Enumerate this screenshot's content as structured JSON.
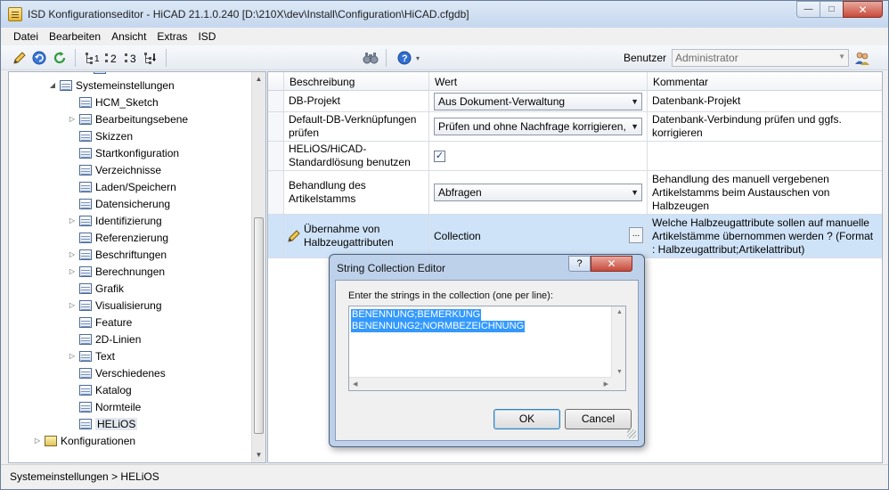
{
  "window": {
    "title": "ISD Konfigurationseditor  -  HiCAD 21.1.0.240 [D:\\210X\\dev\\Install\\Configuration\\HiCAD.cfgdb]",
    "minimize_glyph": "—",
    "maximize_glyph": "□",
    "close_glyph": "✕"
  },
  "menu": [
    "Datei",
    "Bearbeiten",
    "Ansicht",
    "Extras",
    "ISD"
  ],
  "toolbar": {
    "user_label": "Benutzer",
    "user_value": "Administrator",
    "icons": [
      "pencil-icon",
      "undo-icon",
      "refresh-icon",
      "level-icon",
      "level-2-icon",
      "level-3-icon",
      "level-all-icon",
      "binoculars-icon",
      "help-icon",
      "users-icon"
    ]
  },
  "tree": {
    "items": [
      {
        "label": "Systemeinstellungen",
        "indent": 3,
        "expander": "◢",
        "icon": "table"
      },
      {
        "label": "HCM_Sketch",
        "indent": 4,
        "expander": "",
        "icon": "table"
      },
      {
        "label": "Bearbeitungsebene",
        "indent": 4,
        "expander": "▷",
        "icon": "table"
      },
      {
        "label": "Skizzen",
        "indent": 4,
        "expander": "",
        "icon": "table"
      },
      {
        "label": "Startkonfiguration",
        "indent": 4,
        "expander": "",
        "icon": "table"
      },
      {
        "label": "Verzeichnisse",
        "indent": 4,
        "expander": "",
        "icon": "table"
      },
      {
        "label": "Laden/Speichern",
        "indent": 4,
        "expander": "",
        "icon": "table"
      },
      {
        "label": "Datensicherung",
        "indent": 4,
        "expander": "",
        "icon": "table"
      },
      {
        "label": "Identifizierung",
        "indent": 4,
        "expander": "▷",
        "icon": "table"
      },
      {
        "label": "Referenzierung",
        "indent": 4,
        "expander": "",
        "icon": "table"
      },
      {
        "label": "Beschriftungen",
        "indent": 4,
        "expander": "▷",
        "icon": "table"
      },
      {
        "label": "Berechnungen",
        "indent": 4,
        "expander": "▷",
        "icon": "table"
      },
      {
        "label": "Grafik",
        "indent": 4,
        "expander": "",
        "icon": "table"
      },
      {
        "label": "Visualisierung",
        "indent": 4,
        "expander": "▷",
        "icon": "table"
      },
      {
        "label": "Feature",
        "indent": 4,
        "expander": "",
        "icon": "table"
      },
      {
        "label": "2D-Linien",
        "indent": 4,
        "expander": "",
        "icon": "table"
      },
      {
        "label": "Text",
        "indent": 4,
        "expander": "▷",
        "icon": "table"
      },
      {
        "label": "Verschiedenes",
        "indent": 4,
        "expander": "",
        "icon": "table"
      },
      {
        "label": "Katalog",
        "indent": 4,
        "expander": "",
        "icon": "table"
      },
      {
        "label": "Normteile",
        "indent": 4,
        "expander": "",
        "icon": "table"
      },
      {
        "label": "HELiOS",
        "indent": 4,
        "expander": "",
        "icon": "table",
        "selected": true
      },
      {
        "label": "Konfigurationen",
        "indent": 1,
        "expander": "▷",
        "icon": "folder"
      }
    ]
  },
  "grid": {
    "headers": {
      "description": "Beschreibung",
      "value": "Wert",
      "comment": "Kommentar"
    },
    "rows": [
      {
        "description": "DB-Projekt",
        "value_type": "dropdown",
        "value": "Aus Dokument-Verwaltung",
        "comment": "Datenbank-Projekt"
      },
      {
        "description": "Default-DB-Verknüpfungen prüfen",
        "value_type": "dropdown",
        "value": "Prüfen und ohne Nachfrage korrigieren,",
        "comment": "Datenbank-Verbindung prüfen und ggfs. korrigieren"
      },
      {
        "description": "HELiOS/HiCAD-Standardlösung benutzen",
        "value_type": "checkbox",
        "value": "✓",
        "comment": ""
      },
      {
        "description": "Behandlung des Artikelstamms",
        "value_type": "dropdown",
        "value": "Abfragen",
        "comment": "Behandlung des manuell vergebenen Artikelstamms beim Austauschen von Halbzeugen"
      },
      {
        "description": "Übernahme von Halbzeugattributen",
        "value_type": "collection",
        "value": "Collection",
        "button": "...",
        "comment": "Welche Halbzeugattribute sollen auf manuelle Artikelstämme übernommen werden ? (Format : Halbzeugattribut;Artikelattribut)",
        "selected": true
      }
    ]
  },
  "status": {
    "path": "Systemeinstellungen > HELiOS"
  },
  "dialog": {
    "title": "String Collection Editor",
    "help_glyph": "?",
    "close_glyph": "✕",
    "prompt": "Enter the strings in the collection (one per line):",
    "lines": [
      "BENENNUNG;BEMERKUNG",
      "BENENNUNG2;NORMBEZEICHNUNG"
    ],
    "ok_label": "OK",
    "cancel_label": "Cancel"
  }
}
